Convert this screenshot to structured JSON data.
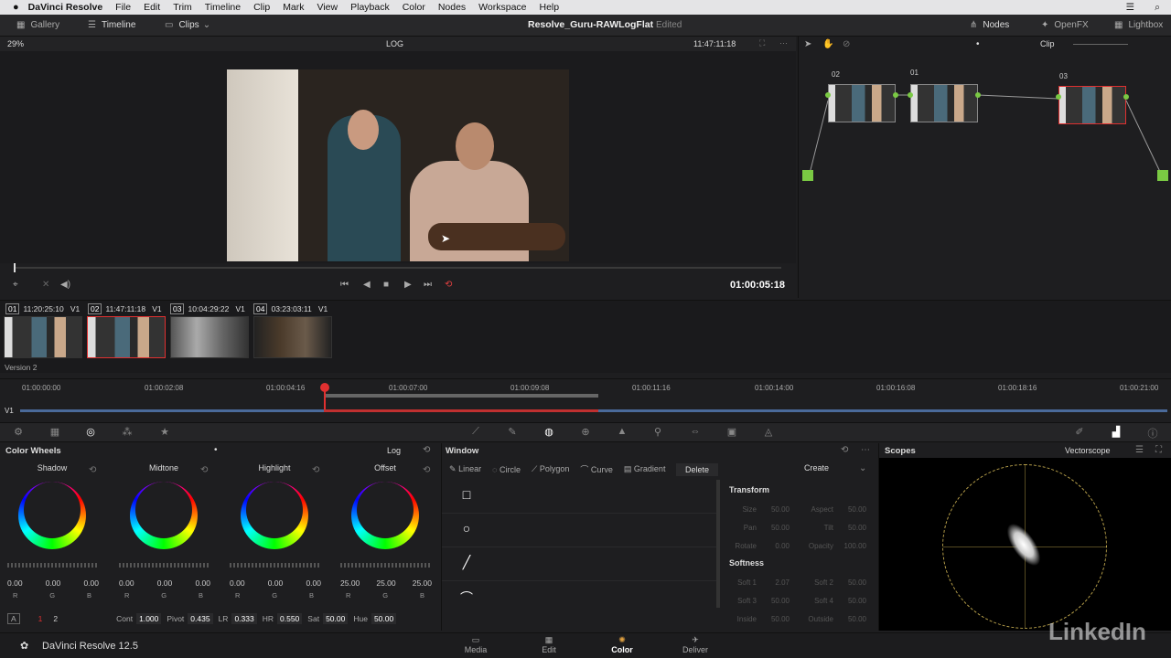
{
  "menubar": {
    "app": "DaVinci Resolve",
    "items": [
      "File",
      "Edit",
      "Trim",
      "Timeline",
      "Clip",
      "Mark",
      "View",
      "Playback",
      "Color",
      "Nodes",
      "Workspace",
      "Help"
    ]
  },
  "toolbar": {
    "gallery": "Gallery",
    "timeline": "Timeline",
    "clips": "Clips",
    "project": "Resolve_Guru-RAWLogFlat",
    "status": "Edited",
    "nodes": "Nodes",
    "openfx": "OpenFX",
    "lightbox": "Lightbox"
  },
  "viewer": {
    "zoom": "29%",
    "mode": "LOG",
    "timecode": "11:47:11:18",
    "clip_label": "Clip",
    "playhead_tc": "01:00:05:18"
  },
  "nodes": [
    {
      "id": "02"
    },
    {
      "id": "01"
    },
    {
      "id": "03"
    }
  ],
  "clips": [
    {
      "num": "01",
      "tc": "11:20:25:10",
      "track": "V1"
    },
    {
      "num": "02",
      "tc": "11:47:11:18",
      "track": "V1"
    },
    {
      "num": "03",
      "tc": "10:04:29:22",
      "track": "V1"
    },
    {
      "num": "04",
      "tc": "03:23:03:11",
      "track": "V1"
    }
  ],
  "version": "Version 2",
  "ruler": [
    "01:00:00:00",
    "01:00:02:08",
    "01:00:04:16",
    "01:00:07:00",
    "01:00:09:08",
    "01:00:11:16",
    "01:00:14:00",
    "01:00:16:08",
    "01:00:18:16",
    "01:00:21:00"
  ],
  "track": "V1",
  "wheels": {
    "title": "Color Wheels",
    "mode": "Log",
    "items": [
      {
        "label": "Shadow",
        "vals": [
          "0.00",
          "0.00",
          "0.00"
        ]
      },
      {
        "label": "Midtone",
        "vals": [
          "0.00",
          "0.00",
          "0.00"
        ]
      },
      {
        "label": "Highlight",
        "vals": [
          "0.00",
          "0.00",
          "0.00"
        ]
      },
      {
        "label": "Offset",
        "vals": [
          "25.00",
          "25.00",
          "25.00"
        ]
      }
    ],
    "rgb": [
      "R",
      "G",
      "B"
    ]
  },
  "adjust": {
    "a": "A",
    "p1": "1",
    "p2": "2",
    "cont_l": "Cont",
    "cont": "1.000",
    "pivot_l": "Pivot",
    "pivot": "0.435",
    "lr_l": "LR",
    "lr": "0.333",
    "hr_l": "HR",
    "hr": "0.550",
    "sat_l": "Sat",
    "sat": "50.00",
    "hue_l": "Hue",
    "hue": "50.00"
  },
  "window": {
    "title": "Window",
    "tools": [
      "Linear",
      "Circle",
      "Polygon",
      "Curve",
      "Gradient"
    ],
    "delete": "Delete",
    "create": "Create",
    "transform": "Transform",
    "softness": "Softness",
    "tprops": [
      [
        "Size",
        "50.00",
        "Aspect",
        "50.00"
      ],
      [
        "Pan",
        "50.00",
        "Tilt",
        "50.00"
      ],
      [
        "Rotate",
        "0.00",
        "Opacity",
        "100.00"
      ]
    ],
    "sprops": [
      [
        "Soft 1",
        "2.07",
        "Soft 2",
        "50.00"
      ],
      [
        "Soft 3",
        "50.00",
        "Soft 4",
        "50.00"
      ],
      [
        "Inside",
        "50.00",
        "Outside",
        "50.00"
      ]
    ]
  },
  "scopes": {
    "title": "Scopes",
    "type": "Vectorscope"
  },
  "bottom": {
    "product": "DaVinci Resolve 12.5",
    "pages": [
      "Media",
      "Edit",
      "Color",
      "Deliver"
    ]
  },
  "watermark": "LinkedIn"
}
